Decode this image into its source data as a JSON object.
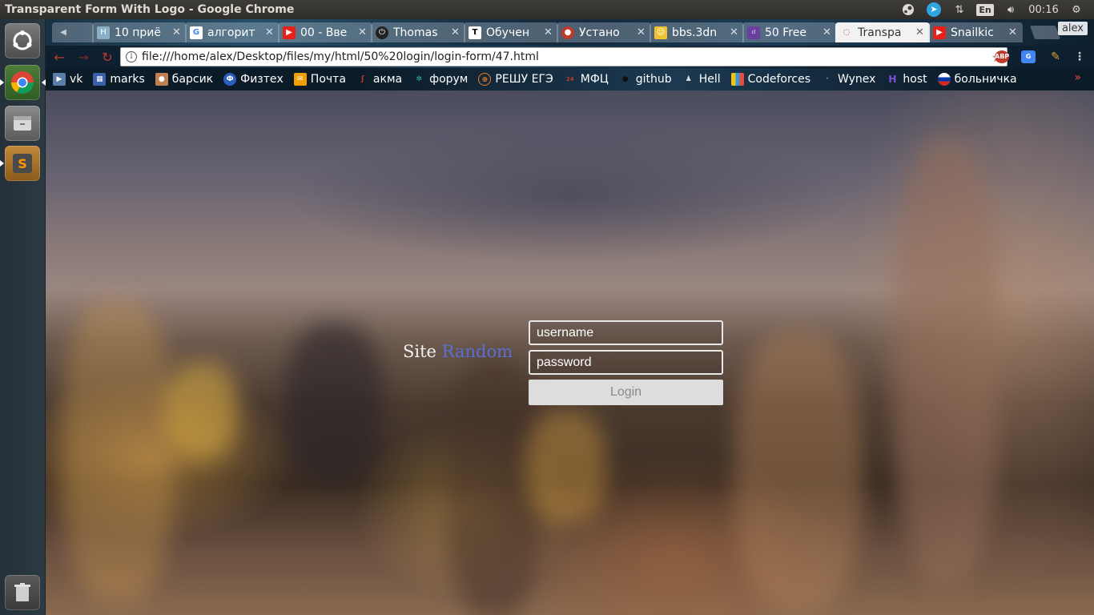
{
  "top_panel": {
    "window_title": "Transparent Form With Logo - Google Chrome",
    "lang": "En",
    "time": "00:16"
  },
  "launcher": {
    "items": [
      "Ubuntu Dash",
      "Google Chrome",
      "Files",
      "Sublime Text",
      "Trash"
    ]
  },
  "tabs": [
    {
      "label": "",
      "icon": "speaker-icon"
    },
    {
      "label": "10 приё",
      "icon": "H"
    },
    {
      "label": "алгорит",
      "icon": "G"
    },
    {
      "label": "00 - Вве",
      "icon": "youtube-icon"
    },
    {
      "label": "Thomas",
      "icon": "T-logo"
    },
    {
      "label": "Обучен",
      "icon": "T"
    },
    {
      "label": "Устано",
      "icon": "red-icon"
    },
    {
      "label": "bbs.3dn",
      "icon": "yellow-icon"
    },
    {
      "label": "50 Free",
      "icon": "colorlib"
    },
    {
      "label": "Transpa",
      "icon": "page-icon",
      "active": true
    },
    {
      "label": "Snailkic",
      "icon": "youtube-icon"
    }
  ],
  "profile": "alex",
  "address_bar": {
    "url": "file:///home/alex/Desktop/files/my/html/50%20login/login-form/47.html"
  },
  "extensions": [
    "ABP",
    "G"
  ],
  "bookmarks": [
    {
      "label": "vk"
    },
    {
      "label": "marks"
    },
    {
      "label": "барсик"
    },
    {
      "label": "Физтех"
    },
    {
      "label": "Почта"
    },
    {
      "label": "акма"
    },
    {
      "label": "форум"
    },
    {
      "label": "РЕШУ ЕГЭ"
    },
    {
      "label": "МФЦ"
    },
    {
      "label": "github"
    },
    {
      "label": "Hell"
    },
    {
      "label": "Codeforces"
    },
    {
      "label": "Wynex"
    },
    {
      "label": "host"
    },
    {
      "label": "больничка"
    }
  ],
  "bookmarks_more": "»",
  "page": {
    "logo_text": "Site",
    "logo_accent": "Random",
    "username_placeholder": "username",
    "password_placeholder": "password",
    "login_label": "Login"
  },
  "colors": {
    "logo_accent": "#5b6ed6",
    "login_button_bg": "#dddddd"
  }
}
